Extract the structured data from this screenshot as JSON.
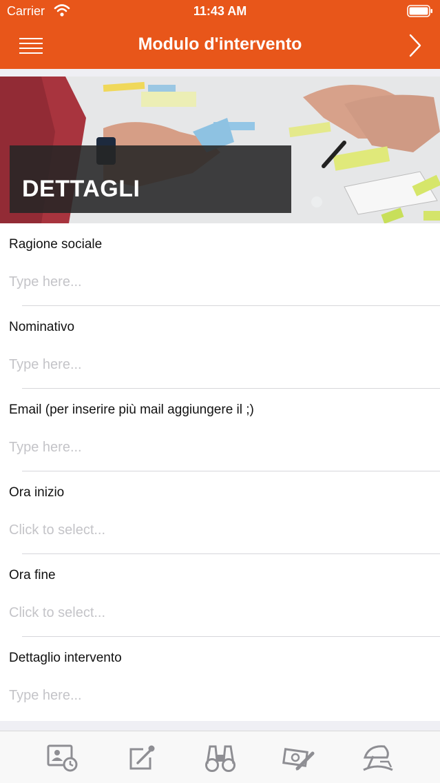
{
  "status_bar": {
    "carrier": "Carrier",
    "time": "11:43 AM"
  },
  "navbar": {
    "title": "Modulo d'intervento",
    "menu_icon": "hamburger-menu-icon",
    "next_icon": "chevron-right-icon"
  },
  "hero": {
    "caption": "DETTAGLI"
  },
  "form": {
    "fields": [
      {
        "label": "Ragione sociale",
        "placeholder": "Type here..."
      },
      {
        "label": "Nominativo",
        "placeholder": "Type here..."
      },
      {
        "label": "Email (per inserire più mail aggiungere il ;)",
        "placeholder": "Type here..."
      },
      {
        "label": "Ora inizio",
        "placeholder": "Click to select..."
      },
      {
        "label": "Ora fine",
        "placeholder": "Click to select..."
      },
      {
        "label": "Dettaglio intervento",
        "placeholder": "Type here..."
      }
    ]
  },
  "tabbar": {
    "tabs": [
      {
        "icon": "contact-clock-icon"
      },
      {
        "icon": "edit-share-icon"
      },
      {
        "icon": "binoculars-icon"
      },
      {
        "icon": "money-edit-icon"
      },
      {
        "icon": "beach-umbrella-icon"
      }
    ]
  },
  "colors": {
    "accent": "#e8561a",
    "tab_icon": "#8e8e93",
    "placeholder": "#c4c4c8"
  }
}
